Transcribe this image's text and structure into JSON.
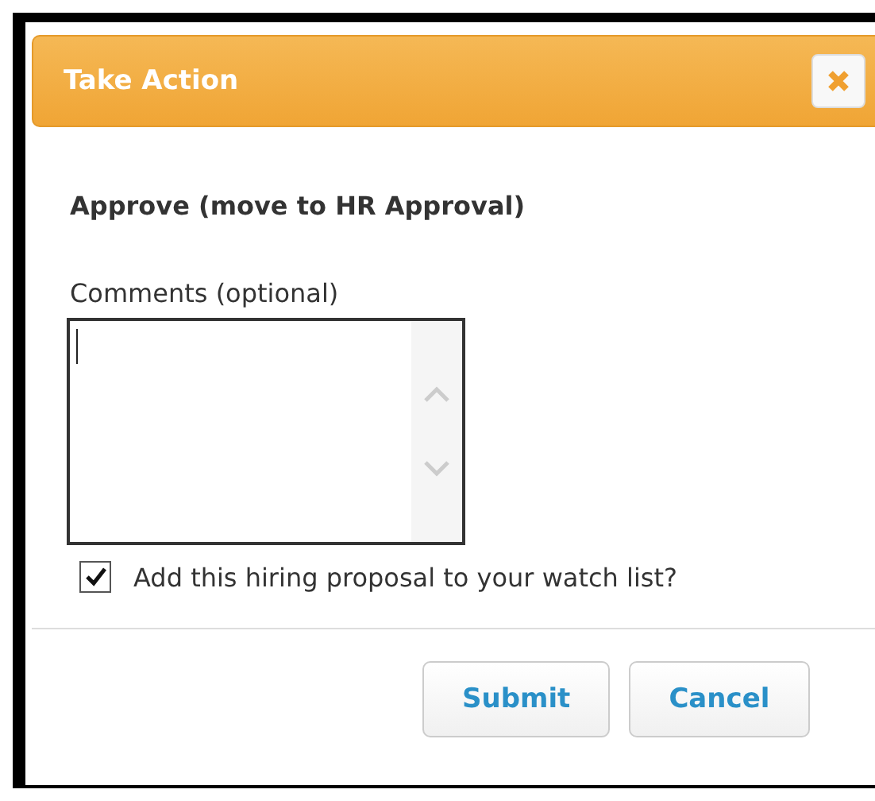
{
  "dialog": {
    "title": "Take Action"
  },
  "action": "Approve (move to HR Approval)",
  "comments": {
    "label": "Comments (optional)",
    "focused": true
  },
  "watch_list": {
    "label": "Add this hiring proposal to your watch list?",
    "checked": true
  },
  "buttons": [
    {
      "label": "Submit"
    },
    {
      "label": "Cancel"
    }
  ]
}
